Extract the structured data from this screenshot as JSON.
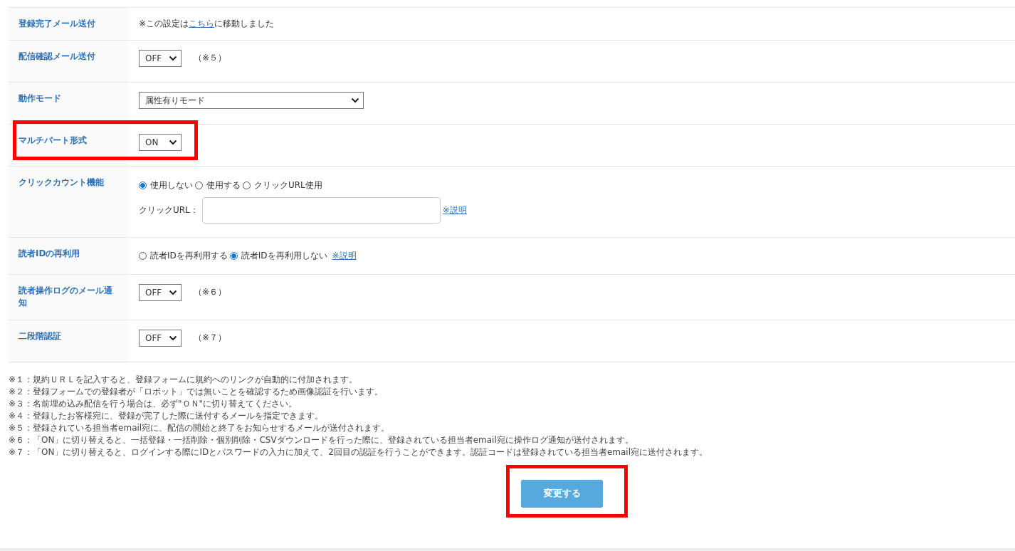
{
  "settings": [
    {
      "kind": "text_link",
      "label": "登録完了メール送付",
      "highlighted": false,
      "before": "※この設定は",
      "link": "こちら",
      "after": "に移動しました"
    },
    {
      "kind": "select",
      "label": "配信確認メール送付",
      "highlighted": false,
      "value": "OFF",
      "note": "（※５）"
    },
    {
      "kind": "wide_select",
      "label": "動作モード",
      "highlighted": false,
      "value": "属性有りモード"
    },
    {
      "kind": "select",
      "label": "マルチパート形式",
      "highlighted": true,
      "value": "ON"
    },
    {
      "kind": "radio_url",
      "label": "クリックカウント機能",
      "highlighted": false,
      "options": [
        {
          "label": "使用しない",
          "selected": true
        },
        {
          "label": "使用する",
          "selected": false
        },
        {
          "label": "クリックURL使用",
          "selected": false
        }
      ],
      "url_label": "クリックURL：",
      "link": "※説明"
    },
    {
      "kind": "radio_link",
      "label": "読者IDの再利用",
      "highlighted": false,
      "options": [
        {
          "label": "読者IDを再利用する",
          "selected": false
        },
        {
          "label": "読者IDを再利用しない",
          "selected": true
        }
      ],
      "link": "※説明"
    },
    {
      "kind": "select",
      "label": "読者操作ログのメール通知",
      "highlighted": false,
      "value": "OFF",
      "note": "（※６）"
    },
    {
      "kind": "select",
      "label": "二段階認証",
      "highlighted": false,
      "value": "OFF",
      "note": "（※７）"
    }
  ],
  "notes": [
    "※１：規約ＵＲＬを記入すると、登録フォームに規約へのリンクが自動的に付加されます。",
    "※２：登録フォームでの登録者が「ロボット」では無いことを確認するため画像認証を行います。",
    "※３：名前埋め込み配信を行う場合は、必ず\"ＯＮ\"に切り替えてください。",
    "※４：登録したお客様宛に、登録が完了した際に送付するメールを指定できます。",
    "※５：登録されている担当者email宛に、配信の開始と終了をお知らせするメールが送付されます。",
    "※６：「ON」に切り替えると、一括登録・一括削除・個別削除・CSVダウンロードを行った際に、登録されている担当者email宛に操作ログ通知が送付されます。",
    "※７：「ON」に切り替えると、ログインする際にIDとパスワードの入力に加えて、2回目の認証を行うことができます。認証コードは登録されている担当者email宛に送付されます。"
  ],
  "submit": {
    "label": "変更する",
    "highlighted": true
  }
}
